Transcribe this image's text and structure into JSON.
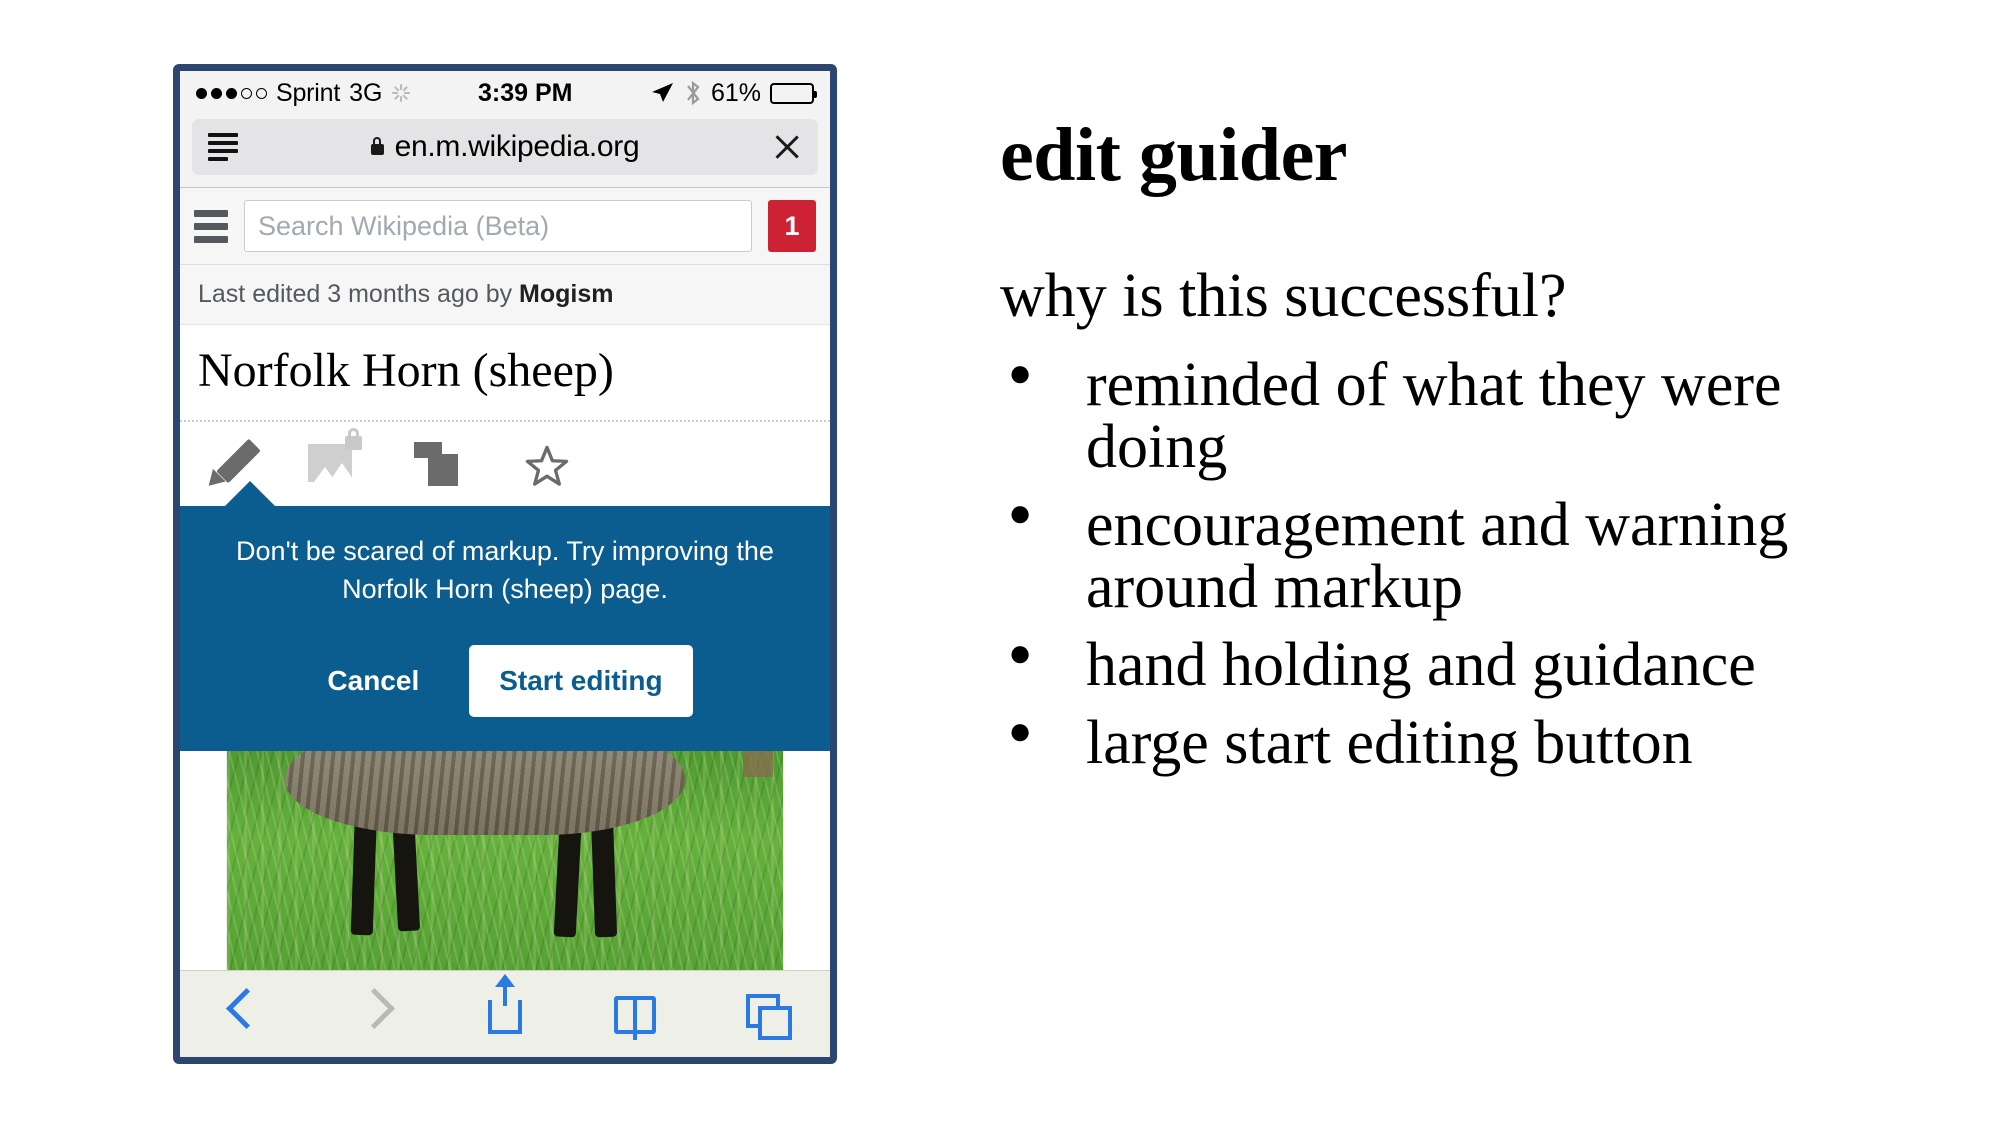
{
  "phone": {
    "statusbar": {
      "carrier": "Sprint",
      "network": "3G",
      "time": "3:39 PM",
      "battery_percent": "61%",
      "signal_dots_filled": 3,
      "signal_dots_total": 5
    },
    "browser": {
      "url": "en.m.wikipedia.org",
      "reader_icon": "reader-lines-icon",
      "lock_icon": "lock-icon",
      "close_icon": "close-icon"
    },
    "wikipedia": {
      "menu_icon": "hamburger-icon",
      "search_placeholder": "Search Wikipedia (Beta)",
      "search_value": "",
      "notification_count": "1",
      "last_edited": "Last edited 3 months ago by ",
      "last_edited_user": "Mogism",
      "article_title": "Norfolk Horn (sheep)",
      "tools": [
        {
          "name": "edit-pencil-icon",
          "label": "Edit"
        },
        {
          "name": "protected-image-icon",
          "label": "Image"
        },
        {
          "name": "pages-icon",
          "label": "Pages"
        },
        {
          "name": "watchlist-star-icon",
          "label": "Watch"
        }
      ]
    },
    "guider": {
      "message": "Don't be scared of markup. Try improving the Norfolk Horn (sheep) page.",
      "cancel_label": "Cancel",
      "start_label": "Start editing",
      "background_color": "#0b5d8f"
    },
    "safari_toolbar": [
      {
        "name": "back-button",
        "state": "enabled"
      },
      {
        "name": "forward-button",
        "state": "disabled"
      },
      {
        "name": "share-button",
        "state": "enabled"
      },
      {
        "name": "bookmarks-button",
        "state": "enabled"
      },
      {
        "name": "tabs-button",
        "state": "enabled"
      }
    ]
  },
  "notes": {
    "heading": "edit guider",
    "subheading": "why is this successful?",
    "bullet_glyph": "●",
    "points": [
      "reminded of what they were doing",
      "encouragement and warning around markup",
      "hand holding and guidance",
      "large start editing button"
    ]
  },
  "colors": {
    "accent_blue": "#0b5d8f",
    "badge_red": "#cc2233",
    "phone_frame": "#2d4670",
    "safari_blue": "#2a7ae2"
  }
}
